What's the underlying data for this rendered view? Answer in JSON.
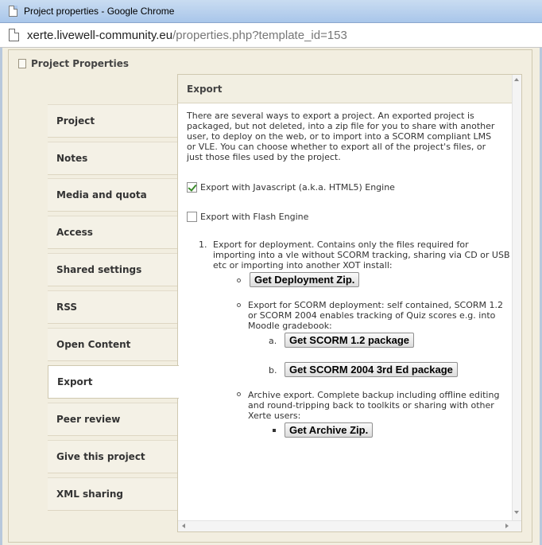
{
  "window": {
    "title": "Project properties - Google Chrome",
    "url_host": "xerte.livewell-community.eu",
    "url_path": "/properties.php?template_id=153"
  },
  "panel": {
    "title": "Project Properties"
  },
  "tabs": [
    {
      "label": "Project",
      "active": false
    },
    {
      "label": "Notes",
      "active": false
    },
    {
      "label": "Media and quota",
      "active": false
    },
    {
      "label": "Access",
      "active": false
    },
    {
      "label": "Shared settings",
      "active": false
    },
    {
      "label": "RSS",
      "active": false
    },
    {
      "label": "Open Content",
      "active": false
    },
    {
      "label": "Export",
      "active": true
    },
    {
      "label": "Peer review",
      "active": false
    },
    {
      "label": "Give this project",
      "active": false
    },
    {
      "label": "XML sharing",
      "active": false
    }
  ],
  "export": {
    "heading": "Export",
    "intro_lines": [
      "There are several ways to export a project. An exported project is",
      "packaged, but not deleted, into a zip file for you to share with another",
      "user, to deploy on the web, or to import into a SCORM compliant LMS",
      "or VLE. You can choose whether to export all of the project's files, or",
      "just those files used by the project."
    ],
    "option_html5": {
      "label": "Export with Javascript (a.k.a. HTML5) Engine",
      "checked": true
    },
    "option_flash": {
      "label": "Export with Flash Engine",
      "checked": false
    },
    "item1_number": "1.",
    "item1_lines": [
      "Export for deployment. Contains only the files required for",
      "importing into a vle without SCORM tracking, sharing via CD or USB",
      "etc or importing into another XOT install:"
    ],
    "deploy_button": "Get Deployment Zip.",
    "scorm_lines": [
      "Export for SCORM deployment: self contained, SCORM 1.2",
      "or SCORM 2004 enables tracking of Quiz scores e.g. into",
      "Moodle gradebook:"
    ],
    "scorm_a_marker": "a.",
    "scorm12_button": "Get SCORM 1.2 package",
    "scorm_b_marker": "b.",
    "scorm2004_button": "Get SCORM 2004 3rd Ed package",
    "archive_lines": [
      "Archive export. Complete backup including offline editing",
      "and round-tripping back to toolkits or sharing with other",
      "Xerte users:"
    ],
    "archive_button": "Get Archive Zip."
  }
}
